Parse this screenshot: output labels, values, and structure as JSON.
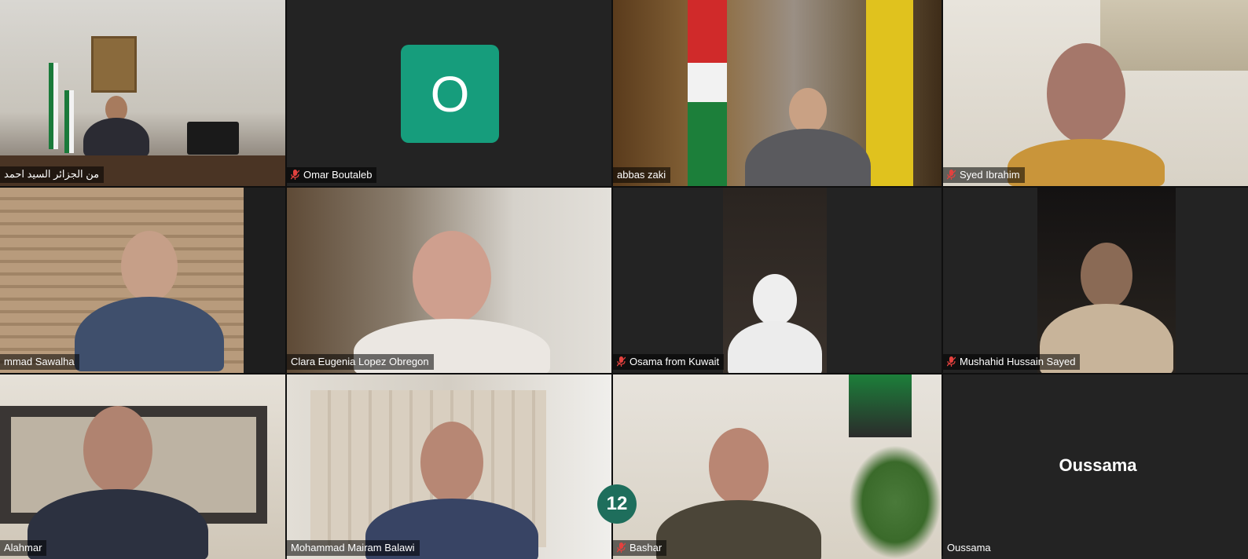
{
  "meeting": {
    "participants": [
      {
        "name": "من الجزائر السيد احمد",
        "muted": false,
        "type": "video"
      },
      {
        "name": "Omar Boutaleb",
        "muted": true,
        "type": "avatar",
        "avatar_letter": "O"
      },
      {
        "name": "abbas zaki",
        "muted": false,
        "type": "video"
      },
      {
        "name": "Syed Ibrahim",
        "muted": true,
        "type": "video"
      },
      {
        "name": "mmad Sawalha",
        "muted": false,
        "type": "video"
      },
      {
        "name": "Clara Eugenia Lopez Obregon",
        "muted": false,
        "type": "video"
      },
      {
        "name": "Osama from Kuwait",
        "muted": true,
        "type": "video"
      },
      {
        "name": "Mushahid Hussain Sayed",
        "muted": true,
        "type": "video"
      },
      {
        "name": "Alahmar",
        "muted": false,
        "type": "video"
      },
      {
        "name": "Mohammad Mairam Balawi",
        "muted": false,
        "type": "video"
      },
      {
        "name": "Bashar",
        "muted": true,
        "type": "video"
      },
      {
        "name": "Oussama",
        "muted": false,
        "type": "name-only",
        "display_name": "Oussama"
      }
    ]
  },
  "overlay_badge": {
    "number": "12"
  },
  "colors": {
    "avatar_bg": "#169d7c",
    "badge_bg": "#1e6e5c",
    "muted_mic": "#e3413e",
    "tile_bg": "#232323"
  }
}
